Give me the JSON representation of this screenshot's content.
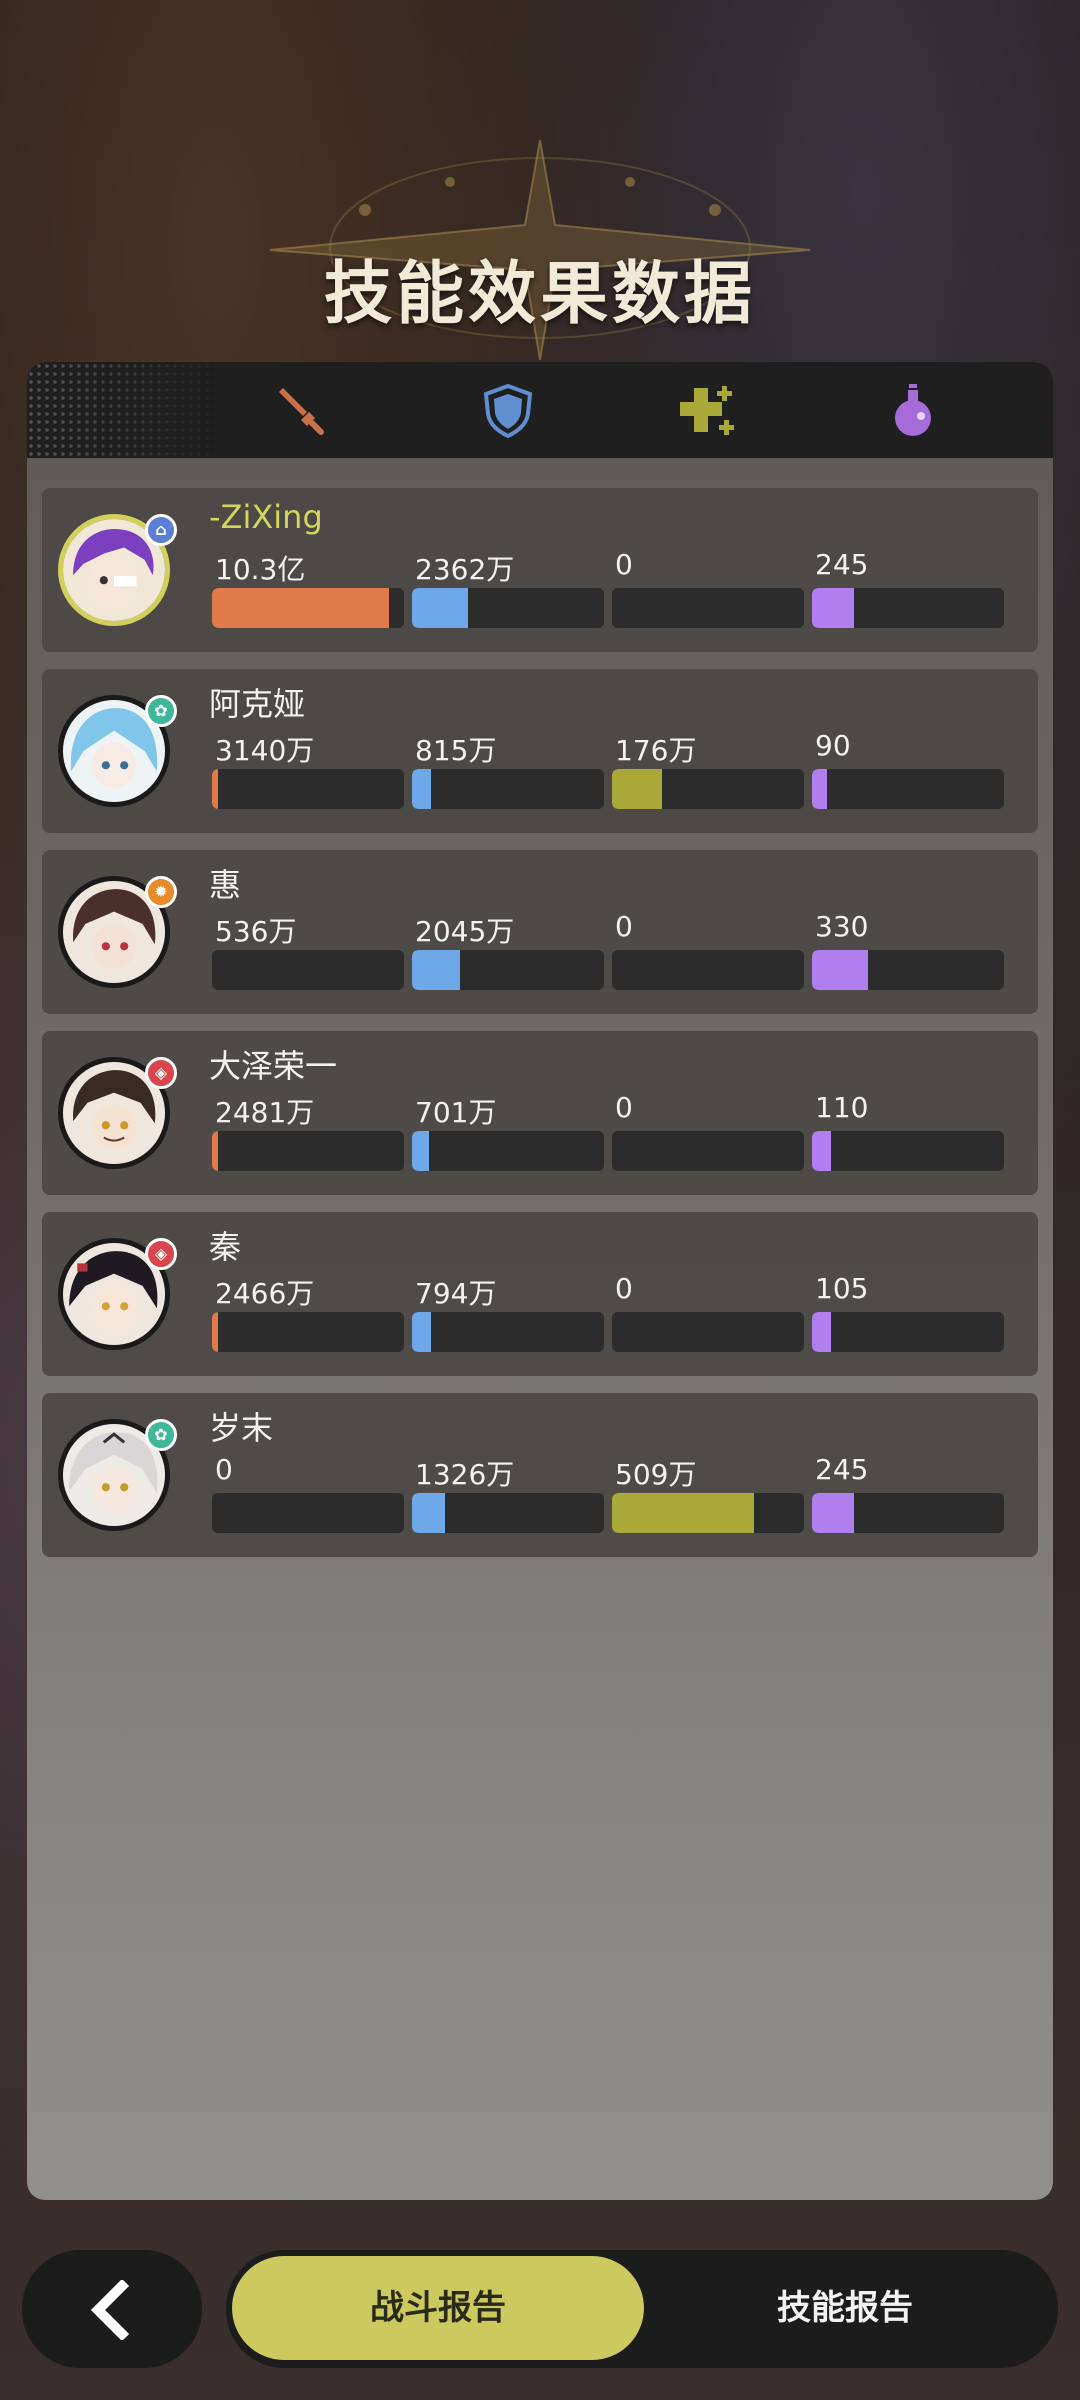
{
  "header": {
    "title": "技能效果数据"
  },
  "tabs_icons": [
    "sword-icon",
    "shield-icon",
    "heal-plus-icon",
    "potion-icon"
  ],
  "colors": {
    "damage": "#e07a48",
    "shield": "#6fa8e8",
    "heal": "#a9a838",
    "effect": "#b17ef0",
    "highlight": "#d3d65c",
    "active_tab": "#ccc95e"
  },
  "players": [
    {
      "name": "-ZiXing",
      "badge_icon": "house-icon",
      "badge_color": "#5b7ed6",
      "stats": [
        "10.3亿",
        "2362万",
        "0",
        "245"
      ],
      "fill": [
        0.92,
        0.29,
        0,
        0.22
      ]
    },
    {
      "name": "阿克娅",
      "badge_icon": "leaf-icon",
      "badge_color": "#3fb89a",
      "stats": [
        "3140万",
        "815万",
        "176万",
        "90"
      ],
      "fill": [
        0.03,
        0.1,
        0.26,
        0.08
      ]
    },
    {
      "name": "惠",
      "badge_icon": "gear-icon",
      "badge_color": "#e68a2a",
      "stats": [
        "536万",
        "2045万",
        "0",
        "330"
      ],
      "fill": [
        0,
        0.25,
        0,
        0.29
      ]
    },
    {
      "name": "大泽荣一",
      "badge_icon": "shield-badge-icon",
      "badge_color": "#d9454a",
      "stats": [
        "2481万",
        "701万",
        "0",
        "110"
      ],
      "fill": [
        0.03,
        0.09,
        0,
        0.1
      ]
    },
    {
      "name": "秦",
      "badge_icon": "shield-badge-icon",
      "badge_color": "#d9454a",
      "stats": [
        "2466万",
        "794万",
        "0",
        "105"
      ],
      "fill": [
        0.03,
        0.1,
        0,
        0.1
      ]
    },
    {
      "name": "岁末",
      "badge_icon": "leaf-icon",
      "badge_color": "#3fb89a",
      "stats": [
        "0",
        "1326万",
        "509万",
        "245"
      ],
      "fill": [
        0,
        0.17,
        0.74,
        0.22
      ]
    }
  ],
  "bottom": {
    "back_icon": "chevron-left-icon",
    "tab_battle": "战斗报告",
    "tab_skill": "技能报告"
  }
}
